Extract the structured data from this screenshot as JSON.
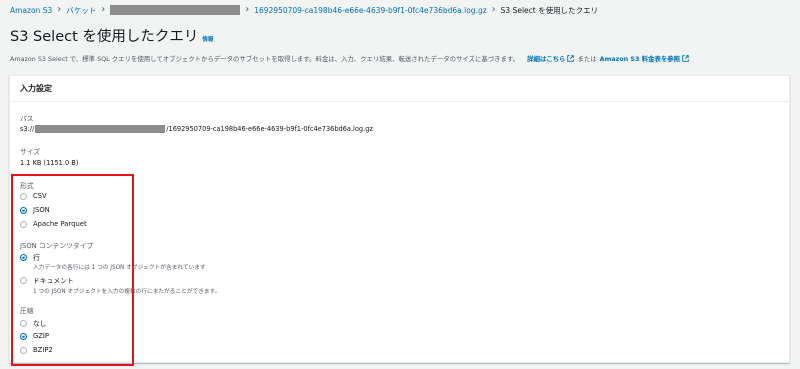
{
  "breadcrumb": {
    "root": "Amazon S3",
    "bucket": "バケット",
    "object": "1692950709-ca198b46-e66e-4639-b9f1-0fc4e736bd6a.log.gz",
    "current": "S3 Select を使用したクエリ"
  },
  "page": {
    "title": "S3 Select を使用したクエリ",
    "info": "情報",
    "description": "Amazon S3 Select で、標準 SQL クエリを使用してオブジェクトからデータのサブセットを取得します。料金は、入力、クエリ結果、転送されたデータのサイズに基づきます。",
    "details_link": "詳細はこちら",
    "or_text": "または",
    "pricing_link": "Amazon S3 料金表を参照"
  },
  "input_settings": {
    "header": "入力設定",
    "path_label": "パス",
    "path_prefix": "s3://",
    "path_suffix": "/1692950709-ca198b46-e66e-4639-b9f1-0fc4e736bd6a.log.gz",
    "size_label": "サイズ",
    "size_value": "1.1 KB (1151.0 B)",
    "format": {
      "label": "形式",
      "options": [
        "CSV",
        "JSON",
        "Apache Parquet"
      ],
      "selected": "JSON"
    },
    "json_type": {
      "label": "JSON コンテンツタイプ",
      "options": [
        {
          "label": "行",
          "desc": "入力データの各行には 1 つの JSON オブジェクトが含まれています"
        },
        {
          "label": "ドキュメント",
          "desc": "1 つの JSON オブジェクトを入力の複数の行にまたがることができます。"
        }
      ],
      "selected": "行"
    },
    "compression": {
      "label": "圧縮",
      "options": [
        "なし",
        "GZIP",
        "BZIP2"
      ],
      "selected": "GZIP"
    }
  },
  "colors": {
    "link": "#0073bb",
    "highlight_box": "#e3141c"
  }
}
